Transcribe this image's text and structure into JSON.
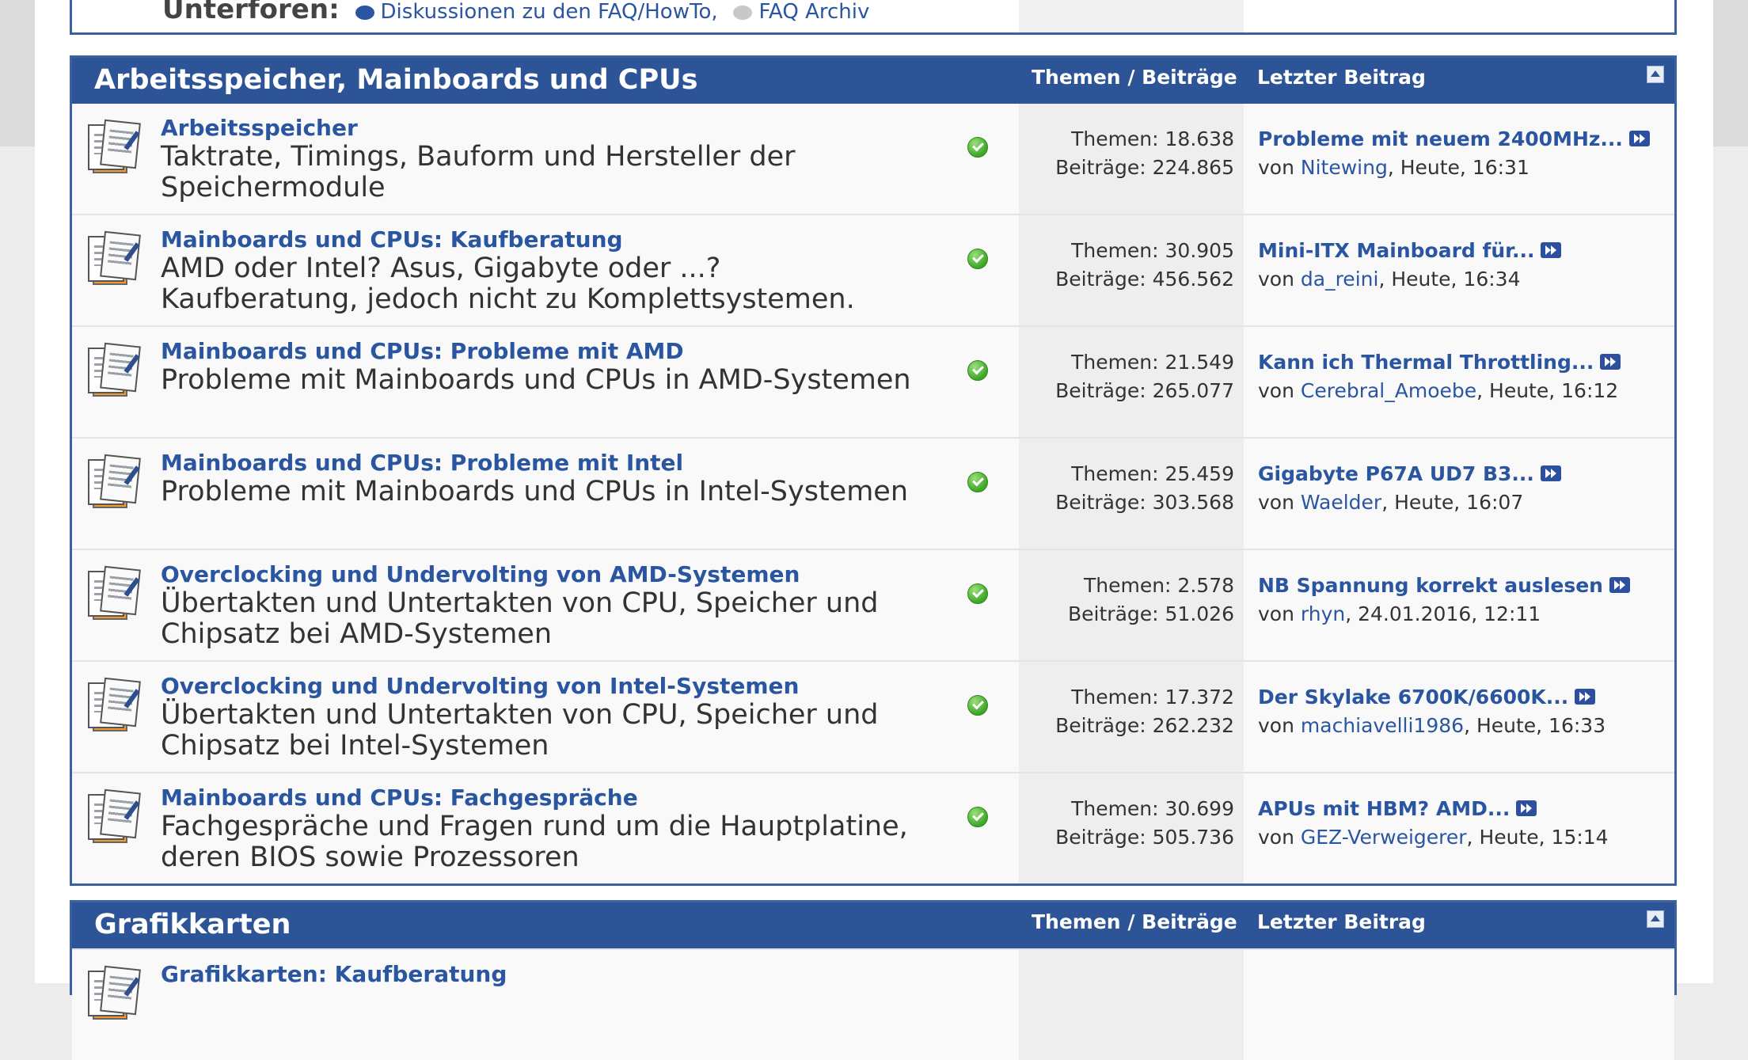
{
  "top": {
    "subforums_label": "Unterforen:",
    "links": [
      "Diskussionen zu den FAQ/HowTo",
      "FAQ Archiv"
    ],
    "link_separator": ","
  },
  "categories": [
    {
      "title": "Arbeitsspeicher, Mainboards und CPUs",
      "col_stats": "Themen / Beiträge",
      "col_last": "Letzter Beitrag",
      "forums": [
        {
          "title": "Arbeitsspeicher",
          "desc": "Taktrate, Timings, Bauform und Hersteller der Speichermodule",
          "themen": "Themen: 18.638",
          "beitraege": "Beiträge: 224.865",
          "last_title": "Probleme mit neuem 2400MHz...",
          "von": "von",
          "user": "Nitewing",
          "time": ", Heute, 16:31"
        },
        {
          "title": "Mainboards und CPUs: Kaufberatung",
          "desc": "AMD oder Intel? Asus, Gigabyte oder ...? Kaufberatung, jedoch nicht zu Komplettsystemen.",
          "themen": "Themen: 30.905",
          "beitraege": "Beiträge: 456.562",
          "last_title": "Mini-ITX Mainboard für...",
          "von": "von",
          "user": "da_reini",
          "time": ", Heute, 16:34"
        },
        {
          "title": "Mainboards und CPUs: Probleme mit AMD",
          "desc": "Probleme mit Mainboards und CPUs in AMD-Systemen",
          "themen": "Themen: 21.549",
          "beitraege": "Beiträge: 265.077",
          "last_title": "Kann ich Thermal Throttling...",
          "von": "von",
          "user": "Cerebral_Amoebe",
          "time": ", Heute, 16:12"
        },
        {
          "title": "Mainboards und CPUs: Probleme mit Intel",
          "desc": "Probleme mit Mainboards und CPUs in Intel-Systemen",
          "themen": "Themen: 25.459",
          "beitraege": "Beiträge: 303.568",
          "last_title": "Gigabyte P67A UD7 B3...",
          "von": "von",
          "user": "Waelder",
          "time": ", Heute, 16:07"
        },
        {
          "title": "Overclocking und Undervolting von AMD-Systemen",
          "desc": "Übertakten und Untertakten von CPU, Speicher und Chipsatz bei AMD-Systemen",
          "themen": "Themen: 2.578",
          "beitraege": "Beiträge: 51.026",
          "last_title": "NB Spannung korrekt auslesen",
          "von": "von",
          "user": "rhyn",
          "time": ", 24.01.2016, 12:11"
        },
        {
          "title": "Overclocking und Undervolting von Intel-Systemen",
          "desc": "Übertakten und Untertakten von CPU, Speicher und Chipsatz bei Intel-Systemen",
          "themen": "Themen: 17.372",
          "beitraege": "Beiträge: 262.232",
          "last_title": "Der Skylake 6700K/6600K...",
          "von": "von",
          "user": "machiavelli1986",
          "time": ", Heute, 16:33"
        },
        {
          "title": "Mainboards und CPUs: Fachgespräche",
          "desc": "Fachgespräche und Fragen rund um die Hauptplatine, deren BIOS sowie Prozessoren",
          "themen": "Themen: 30.699",
          "beitraege": "Beiträge: 505.736",
          "last_title": "APUs mit HBM? AMD...",
          "von": "von",
          "user": "GEZ-Verweigerer",
          "time": ", Heute, 15:14"
        }
      ]
    },
    {
      "title": "Grafikkarten",
      "col_stats": "Themen / Beiträge",
      "col_last": "Letzter Beitrag",
      "forums": [
        {
          "title": "Grafikkarten: Kaufberatung"
        }
      ]
    }
  ],
  "colors": {
    "header_bg": "#2d5497",
    "link": "#2a55a0",
    "border": "#3a62a3"
  }
}
